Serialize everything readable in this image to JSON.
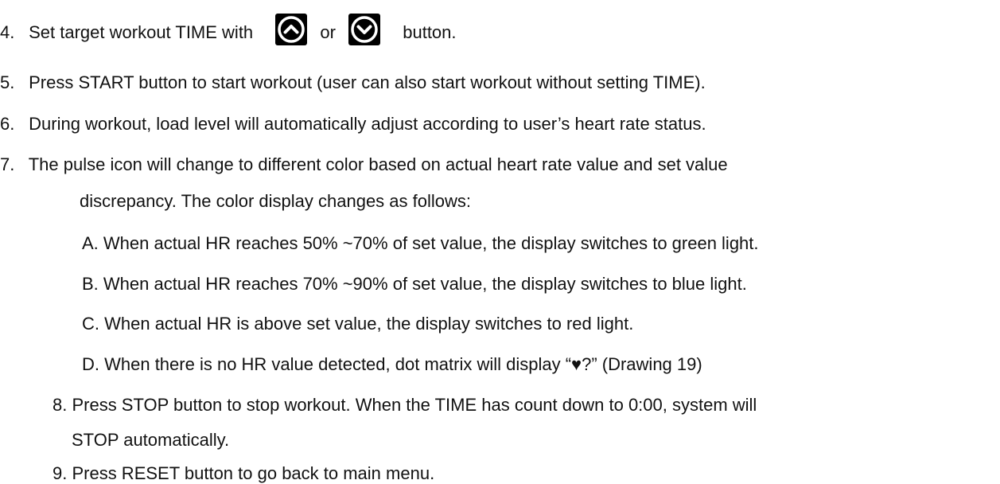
{
  "items": [
    {
      "num": "4.",
      "before": "Set target workout TIME with",
      "mid": "or",
      "after": "button."
    },
    {
      "num": "5.",
      "text": "Press START button to start workout (user can also start workout without setting TIME)."
    },
    {
      "num": "6.",
      "text": "During workout, load level will automatically adjust according to user’s heart rate status."
    },
    {
      "num": "7.",
      "text": "The pulse icon will change to different color based on actual heart rate value and set value",
      "cont": "discrepancy. The color display changes as follows:"
    }
  ],
  "sub": [
    "A. When actual HR reaches 50% ~70% of set value, the display switches to green light.",
    "B. When actual HR reaches 70% ~90% of set value, the display switches to blue light.",
    "C. When actual HR is above set value, the display switches to red light.",
    "D. When there is no HR value detected, dot matrix will display “♥?” (Drawing 19)"
  ],
  "tail": [
    {
      "text": "8. Press STOP button to stop workout. When the TIME has count down to 0:00, system will",
      "cont": "STOP automatically."
    },
    {
      "text": "9. Press RESET button to go back to main menu."
    }
  ],
  "icons": {
    "up": "chevron-up-circle-icon",
    "down": "chevron-down-circle-icon",
    "icon_bg": "#000000",
    "icon_fg": "#ffffff"
  }
}
